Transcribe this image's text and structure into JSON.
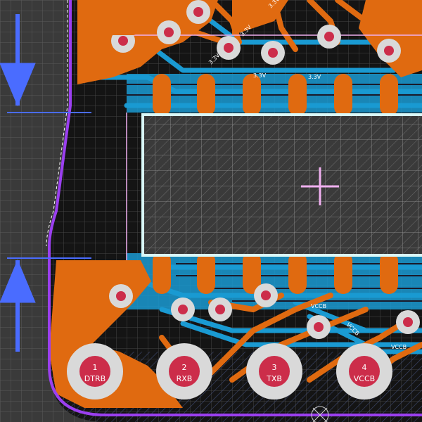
{
  "board": {
    "colors": {
      "background": "#1c1c1c",
      "grid": "#555555",
      "outside": "#3a3a3a",
      "copper_top": "#e06a10",
      "copper_bottom": "#1a9ad2",
      "outline": "#9b3ff0",
      "silkscreen": "#d8f8f8",
      "pad_ring": "#d9d9d9",
      "drill": "#cc2d4a",
      "dimension": "#4a6cff",
      "crosshair": "#f0b0f0"
    },
    "net_labels": [
      "3.3V",
      "3.3V",
      "3.3V",
      "3.3V",
      "3.3V",
      "VCCB",
      "VCCB",
      "VCCB"
    ],
    "header_pads": [
      {
        "number": "1",
        "net": "DTRB"
      },
      {
        "number": "2",
        "net": "RXB"
      },
      {
        "number": "3",
        "net": "TXB"
      },
      {
        "number": "4",
        "net": "VCCB"
      }
    ]
  }
}
